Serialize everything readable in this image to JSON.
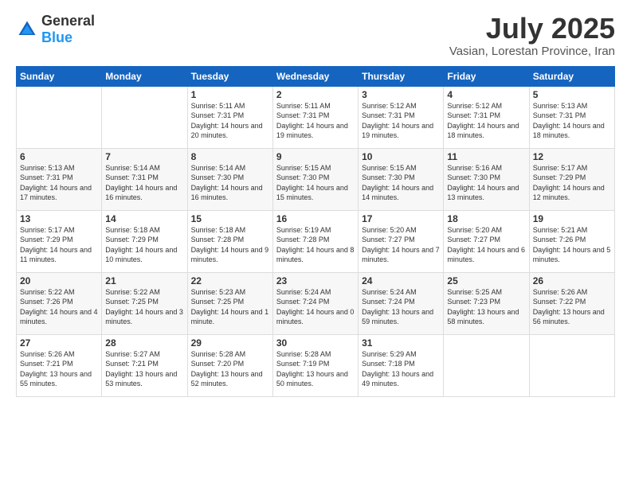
{
  "logo": {
    "text_general": "General",
    "text_blue": "Blue"
  },
  "header": {
    "month": "July 2025",
    "location": "Vasian, Lorestan Province, Iran"
  },
  "weekdays": [
    "Sunday",
    "Monday",
    "Tuesday",
    "Wednesday",
    "Thursday",
    "Friday",
    "Saturday"
  ],
  "weeks": [
    [
      {
        "day": "",
        "info": ""
      },
      {
        "day": "",
        "info": ""
      },
      {
        "day": "1",
        "info": "Sunrise: 5:11 AM\nSunset: 7:31 PM\nDaylight: 14 hours and 20 minutes."
      },
      {
        "day": "2",
        "info": "Sunrise: 5:11 AM\nSunset: 7:31 PM\nDaylight: 14 hours and 19 minutes."
      },
      {
        "day": "3",
        "info": "Sunrise: 5:12 AM\nSunset: 7:31 PM\nDaylight: 14 hours and 19 minutes."
      },
      {
        "day": "4",
        "info": "Sunrise: 5:12 AM\nSunset: 7:31 PM\nDaylight: 14 hours and 18 minutes."
      },
      {
        "day": "5",
        "info": "Sunrise: 5:13 AM\nSunset: 7:31 PM\nDaylight: 14 hours and 18 minutes."
      }
    ],
    [
      {
        "day": "6",
        "info": "Sunrise: 5:13 AM\nSunset: 7:31 PM\nDaylight: 14 hours and 17 minutes."
      },
      {
        "day": "7",
        "info": "Sunrise: 5:14 AM\nSunset: 7:31 PM\nDaylight: 14 hours and 16 minutes."
      },
      {
        "day": "8",
        "info": "Sunrise: 5:14 AM\nSunset: 7:30 PM\nDaylight: 14 hours and 16 minutes."
      },
      {
        "day": "9",
        "info": "Sunrise: 5:15 AM\nSunset: 7:30 PM\nDaylight: 14 hours and 15 minutes."
      },
      {
        "day": "10",
        "info": "Sunrise: 5:15 AM\nSunset: 7:30 PM\nDaylight: 14 hours and 14 minutes."
      },
      {
        "day": "11",
        "info": "Sunrise: 5:16 AM\nSunset: 7:30 PM\nDaylight: 14 hours and 13 minutes."
      },
      {
        "day": "12",
        "info": "Sunrise: 5:17 AM\nSunset: 7:29 PM\nDaylight: 14 hours and 12 minutes."
      }
    ],
    [
      {
        "day": "13",
        "info": "Sunrise: 5:17 AM\nSunset: 7:29 PM\nDaylight: 14 hours and 11 minutes."
      },
      {
        "day": "14",
        "info": "Sunrise: 5:18 AM\nSunset: 7:29 PM\nDaylight: 14 hours and 10 minutes."
      },
      {
        "day": "15",
        "info": "Sunrise: 5:18 AM\nSunset: 7:28 PM\nDaylight: 14 hours and 9 minutes."
      },
      {
        "day": "16",
        "info": "Sunrise: 5:19 AM\nSunset: 7:28 PM\nDaylight: 14 hours and 8 minutes."
      },
      {
        "day": "17",
        "info": "Sunrise: 5:20 AM\nSunset: 7:27 PM\nDaylight: 14 hours and 7 minutes."
      },
      {
        "day": "18",
        "info": "Sunrise: 5:20 AM\nSunset: 7:27 PM\nDaylight: 14 hours and 6 minutes."
      },
      {
        "day": "19",
        "info": "Sunrise: 5:21 AM\nSunset: 7:26 PM\nDaylight: 14 hours and 5 minutes."
      }
    ],
    [
      {
        "day": "20",
        "info": "Sunrise: 5:22 AM\nSunset: 7:26 PM\nDaylight: 14 hours and 4 minutes."
      },
      {
        "day": "21",
        "info": "Sunrise: 5:22 AM\nSunset: 7:25 PM\nDaylight: 14 hours and 3 minutes."
      },
      {
        "day": "22",
        "info": "Sunrise: 5:23 AM\nSunset: 7:25 PM\nDaylight: 14 hours and 1 minute."
      },
      {
        "day": "23",
        "info": "Sunrise: 5:24 AM\nSunset: 7:24 PM\nDaylight: 14 hours and 0 minutes."
      },
      {
        "day": "24",
        "info": "Sunrise: 5:24 AM\nSunset: 7:24 PM\nDaylight: 13 hours and 59 minutes."
      },
      {
        "day": "25",
        "info": "Sunrise: 5:25 AM\nSunset: 7:23 PM\nDaylight: 13 hours and 58 minutes."
      },
      {
        "day": "26",
        "info": "Sunrise: 5:26 AM\nSunset: 7:22 PM\nDaylight: 13 hours and 56 minutes."
      }
    ],
    [
      {
        "day": "27",
        "info": "Sunrise: 5:26 AM\nSunset: 7:21 PM\nDaylight: 13 hours and 55 minutes."
      },
      {
        "day": "28",
        "info": "Sunrise: 5:27 AM\nSunset: 7:21 PM\nDaylight: 13 hours and 53 minutes."
      },
      {
        "day": "29",
        "info": "Sunrise: 5:28 AM\nSunset: 7:20 PM\nDaylight: 13 hours and 52 minutes."
      },
      {
        "day": "30",
        "info": "Sunrise: 5:28 AM\nSunset: 7:19 PM\nDaylight: 13 hours and 50 minutes."
      },
      {
        "day": "31",
        "info": "Sunrise: 5:29 AM\nSunset: 7:18 PM\nDaylight: 13 hours and 49 minutes."
      },
      {
        "day": "",
        "info": ""
      },
      {
        "day": "",
        "info": ""
      }
    ]
  ]
}
